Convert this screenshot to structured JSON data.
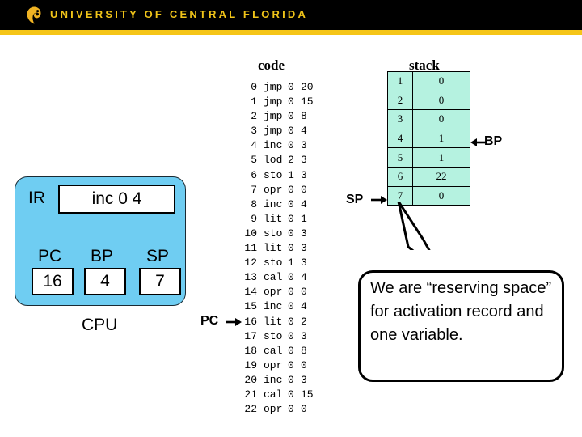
{
  "header": {
    "wordmark": "UNIVERSITY OF CENTRAL FLORIDA",
    "logo_icon": "pegasus-logo-icon",
    "bar_color": "#000000",
    "stripe_color": "#f5c518",
    "text_color": "#f0c419"
  },
  "headings": {
    "code": "code",
    "stack": "stack"
  },
  "code": {
    "lines": [
      {
        "num": "0",
        "op": "jmp",
        "l": "0",
        "m": "20"
      },
      {
        "num": "1",
        "op": "jmp",
        "l": "0",
        "m": "15"
      },
      {
        "num": "2",
        "op": "jmp",
        "l": "0",
        "m": "8"
      },
      {
        "num": "3",
        "op": "jmp",
        "l": "0",
        "m": "4"
      },
      {
        "num": "4",
        "op": "inc",
        "l": "0",
        "m": "3"
      },
      {
        "num": "5",
        "op": "lod",
        "l": "2",
        "m": "3"
      },
      {
        "num": "6",
        "op": "sto",
        "l": "1",
        "m": "3"
      },
      {
        "num": "7",
        "op": "opr",
        "l": "0",
        "m": "0"
      },
      {
        "num": "8",
        "op": "inc",
        "l": "0",
        "m": "4"
      },
      {
        "num": "9",
        "op": "lit",
        "l": "0",
        "m": "1"
      },
      {
        "num": "10",
        "op": "sto",
        "l": "0",
        "m": "3"
      },
      {
        "num": "11",
        "op": "lit",
        "l": "0",
        "m": "3"
      },
      {
        "num": "12",
        "op": "sto",
        "l": "1",
        "m": "3"
      },
      {
        "num": "13",
        "op": "cal",
        "l": "0",
        "m": "4"
      },
      {
        "num": "14",
        "op": "opr",
        "l": "0",
        "m": "0"
      },
      {
        "num": "15",
        "op": "inc",
        "l": "0",
        "m": "4"
      },
      {
        "num": "16",
        "op": "lit",
        "l": "0",
        "m": "2"
      },
      {
        "num": "17",
        "op": "sto",
        "l": "0",
        "m": "3"
      },
      {
        "num": "18",
        "op": "cal",
        "l": "0",
        "m": "8"
      },
      {
        "num": "19",
        "op": "opr",
        "l": "0",
        "m": "0"
      },
      {
        "num": "20",
        "op": "inc",
        "l": "0",
        "m": "3"
      },
      {
        "num": "21",
        "op": "cal",
        "l": "0",
        "m": "15"
      },
      {
        "num": "22",
        "op": "opr",
        "l": "0",
        "m": "0"
      }
    ]
  },
  "stack": {
    "cell_color": "#b5f2e0",
    "rows": [
      {
        "index": "1",
        "value": "0"
      },
      {
        "index": "2",
        "value": "0"
      },
      {
        "index": "3",
        "value": "0"
      },
      {
        "index": "4",
        "value": "1"
      },
      {
        "index": "5",
        "value": "1"
      },
      {
        "index": "6",
        "value": "22"
      },
      {
        "index": "7",
        "value": "0"
      }
    ]
  },
  "pointers": {
    "sp_label": "SP",
    "bp_label": "BP",
    "pc_label": "PC"
  },
  "cpu": {
    "box_color": "#6fcdf2",
    "title": "CPU",
    "ir_label": "IR",
    "ir_value": "inc 0 4",
    "registers": [
      {
        "name": "PC",
        "value": "16"
      },
      {
        "name": "BP",
        "value": "4"
      },
      {
        "name": "SP",
        "value": "7"
      }
    ]
  },
  "callout": {
    "text": "We are “reserving space” for activation record and one variable."
  }
}
